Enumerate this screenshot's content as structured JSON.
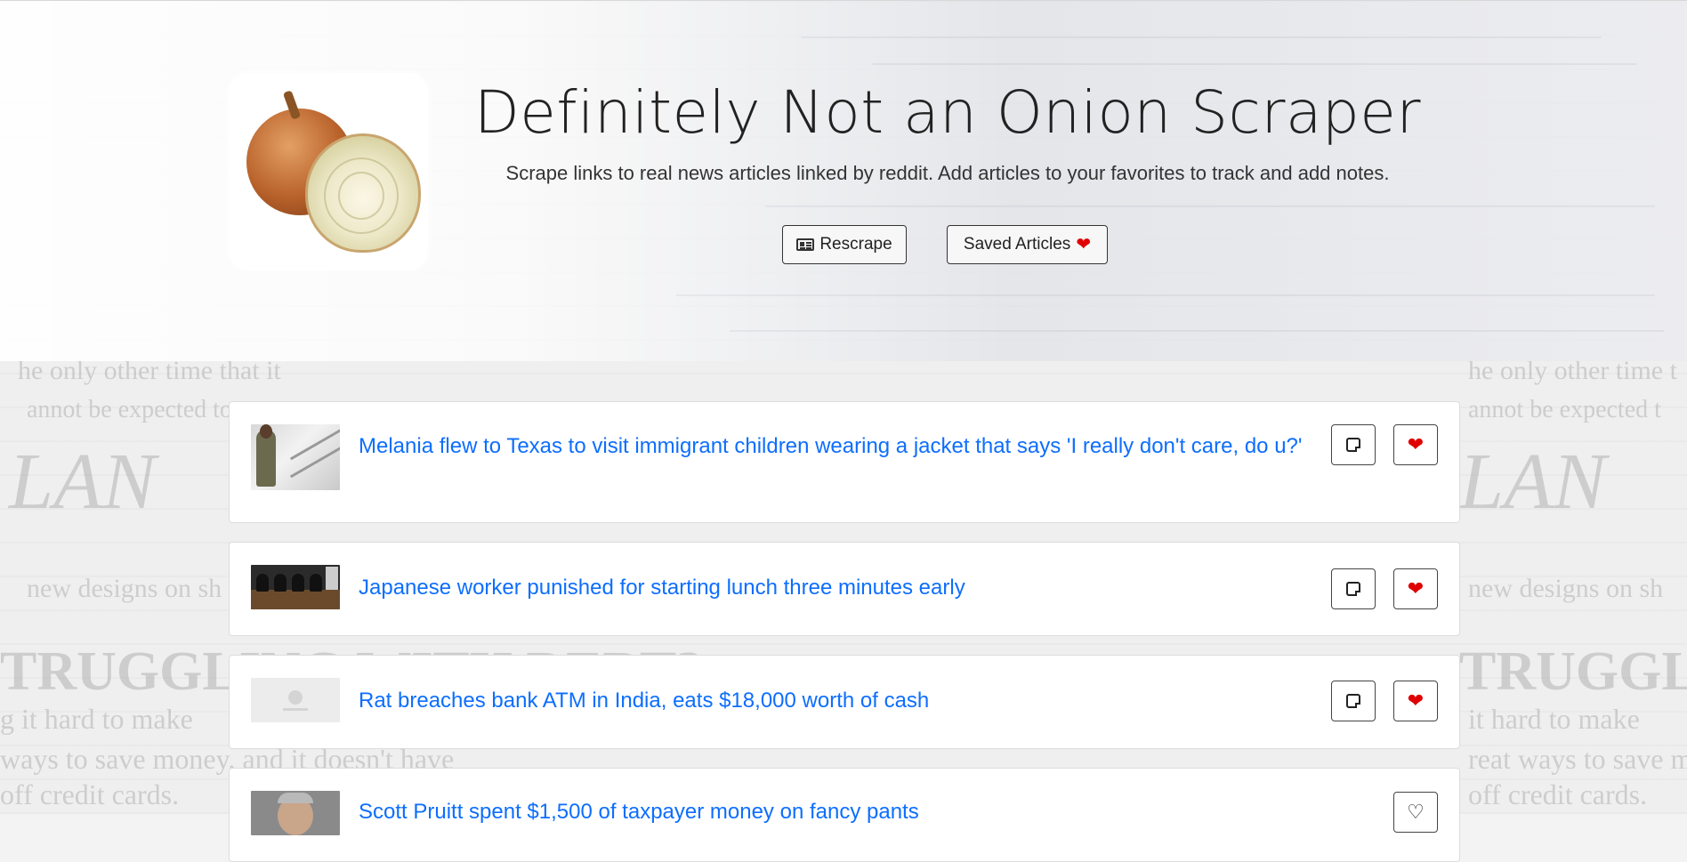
{
  "header": {
    "title": "Definitely Not an Onion Scraper",
    "subtitle": "Scrape links to real news articles linked by reddit. Add articles to your favorites to track and add notes.",
    "rescrape_label": "Rescrape",
    "saved_label": "Saved Articles"
  },
  "articles": [
    {
      "title": "Melania flew to Texas to visit immigrant children wearing a jacket that says 'I really don't care, do u?'",
      "saved": true
    },
    {
      "title": "Japanese worker punished for starting lunch three minutes early",
      "saved": true
    },
    {
      "title": "Rat breaches bank ATM in India, eats $18,000 worth of cash",
      "saved": true
    },
    {
      "title": "Scott Pruitt spent $1,500 of taxpayer money on fancy pants",
      "saved": false
    }
  ],
  "icons": {
    "rescrape": "newspaper-icon",
    "saved": "heart-icon",
    "note": "note-icon",
    "favorite": "heart-icon"
  },
  "colors": {
    "link": "#0d6efd",
    "heart": "#e00000"
  }
}
